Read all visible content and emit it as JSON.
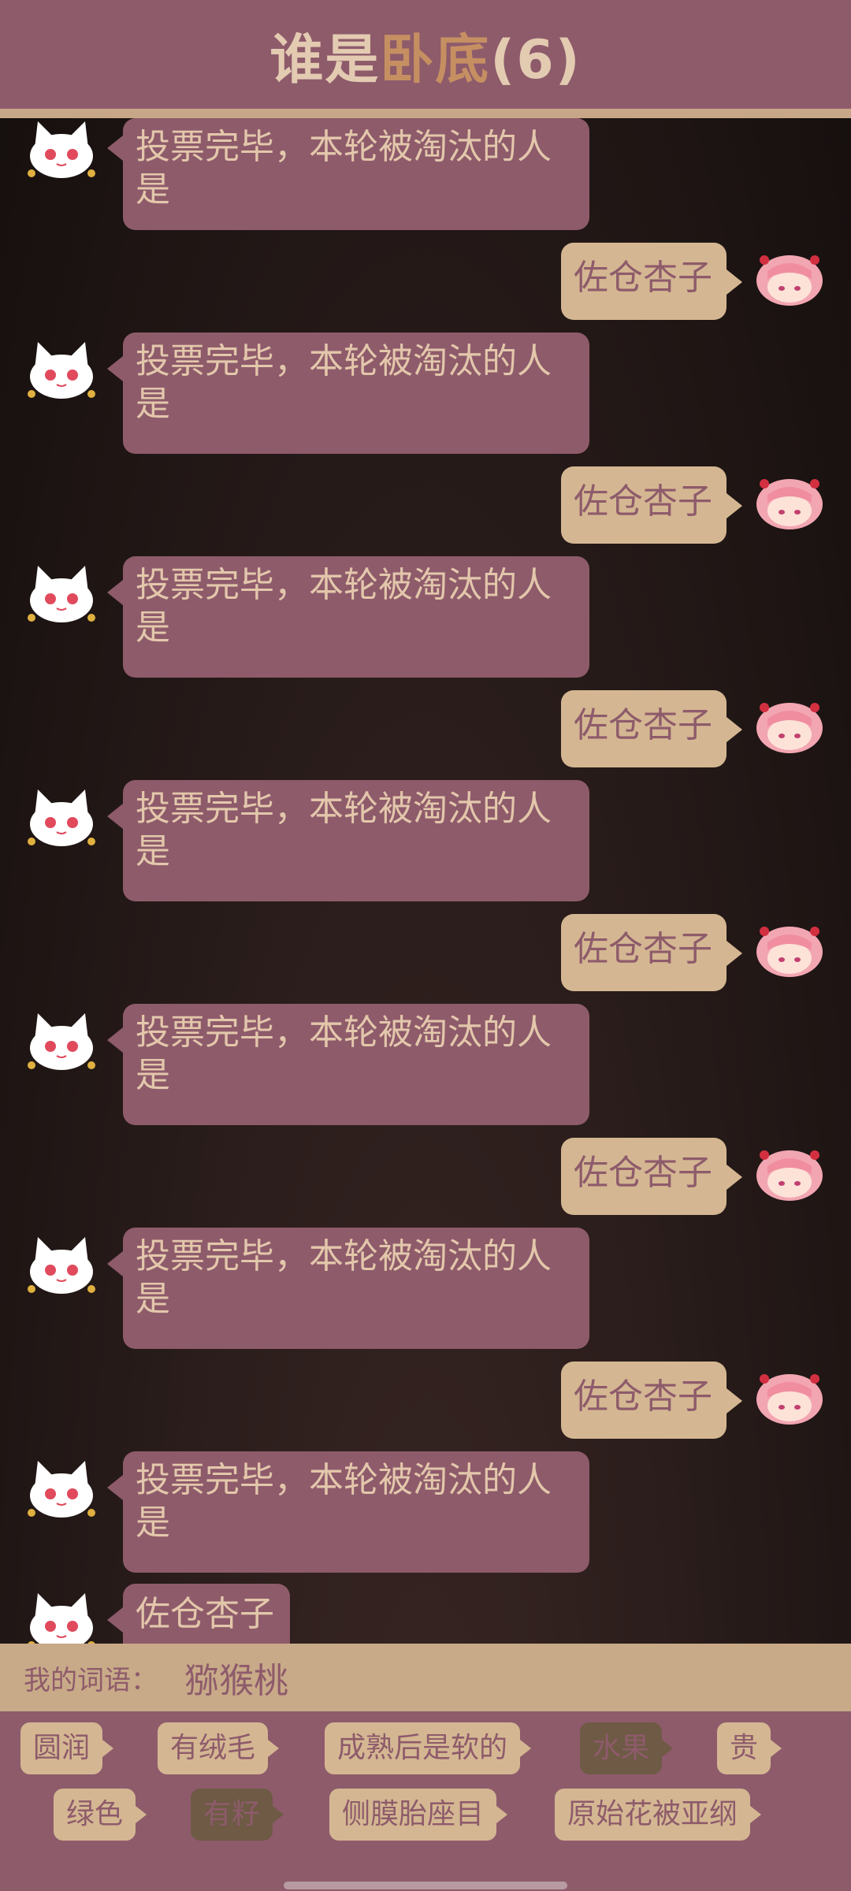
{
  "header": {
    "title_part1": "谁是",
    "title_part2": "卧底",
    "title_part3": "(6)"
  },
  "messages": [
    {
      "side": "left",
      "speaker": "white-cat",
      "text": "投票完毕，本轮被淘汰的人是"
    },
    {
      "side": "right",
      "speaker": "pink-hair-girl",
      "text": "佐仓杏子"
    },
    {
      "side": "left",
      "speaker": "white-cat",
      "text": "投票完毕，本轮被淘汰的人是"
    },
    {
      "side": "right",
      "speaker": "pink-hair-girl",
      "text": "佐仓杏子"
    },
    {
      "side": "left",
      "speaker": "white-cat",
      "text": "投票完毕，本轮被淘汰的人是"
    },
    {
      "side": "right",
      "speaker": "pink-hair-girl",
      "text": "佐仓杏子"
    },
    {
      "side": "left",
      "speaker": "white-cat",
      "text": "投票完毕，本轮被淘汰的人是"
    },
    {
      "side": "right",
      "speaker": "pink-hair-girl",
      "text": "佐仓杏子"
    },
    {
      "side": "left",
      "speaker": "white-cat",
      "text": "投票完毕，本轮被淘汰的人是"
    },
    {
      "side": "right",
      "speaker": "pink-hair-girl",
      "text": "佐仓杏子"
    },
    {
      "side": "left",
      "speaker": "white-cat",
      "text": "投票完毕，本轮被淘汰的人是"
    },
    {
      "side": "right",
      "speaker": "pink-hair-girl",
      "text": "佐仓杏子"
    },
    {
      "side": "left",
      "speaker": "white-cat",
      "text": "投票完毕，本轮被淘汰的人是"
    },
    {
      "side": "left",
      "speaker": "white-cat",
      "text": "佐仓杏子"
    }
  ],
  "my_word": {
    "label": "我的词语：",
    "value": "猕猴桃"
  },
  "tags": [
    {
      "text": "圆润",
      "disabled": false
    },
    {
      "text": "有绒毛",
      "disabled": false
    },
    {
      "text": "成熟后是软的",
      "disabled": false
    },
    {
      "text": "水果",
      "disabled": true
    },
    {
      "text": "贵",
      "disabled": false
    },
    {
      "text": "绿色",
      "disabled": false
    },
    {
      "text": "有籽",
      "disabled": true
    },
    {
      "text": "侧膜胎座目",
      "disabled": false
    },
    {
      "text": "原始花被亚纲",
      "disabled": false
    }
  ],
  "colors": {
    "brand": "#8e5b6b",
    "accent": "#d4b792",
    "title_light": "#e3cbb1",
    "title_accent": "#c58f62"
  }
}
